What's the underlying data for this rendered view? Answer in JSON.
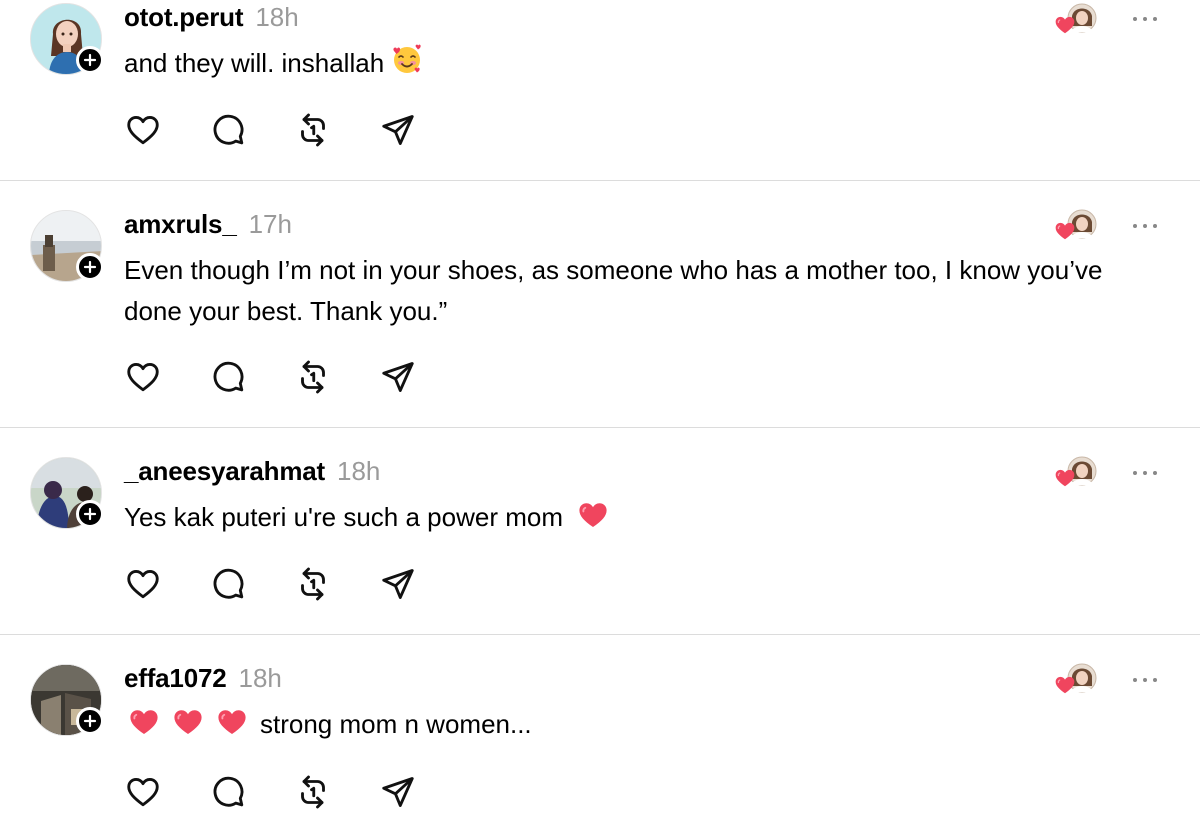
{
  "posts": [
    {
      "username": "otot.perut",
      "time": "18h",
      "text": "and they will. inshallah",
      "emoji": "smiling-face-with-hearts",
      "avatar": "avatar-illustrated-girl"
    },
    {
      "username": "amxruls_",
      "time": "17h",
      "text": "Even though I’m not in your shoes, as someone who has a mother too, I know you’ve done your best. Thank you.”",
      "avatar": "avatar-photo-landscape"
    },
    {
      "username": "_aneesyarahmat",
      "time": "18h",
      "text": "Yes kak puteri u're such a power mom",
      "emoji": "heart",
      "avatar": "avatar-photo-people"
    },
    {
      "username": "effa1072",
      "time": "18h",
      "text": "strong mom n women...",
      "emoji_prefix": [
        "heart",
        "heart",
        "heart"
      ],
      "avatar": "avatar-photo-dark"
    }
  ],
  "actions": [
    "like-icon",
    "comment-icon",
    "repost-icon",
    "share-icon"
  ],
  "colors": {
    "username": "#000000",
    "time": "#9a9a9a",
    "heart": "#f0455e",
    "divider": "#dcdcdc"
  }
}
